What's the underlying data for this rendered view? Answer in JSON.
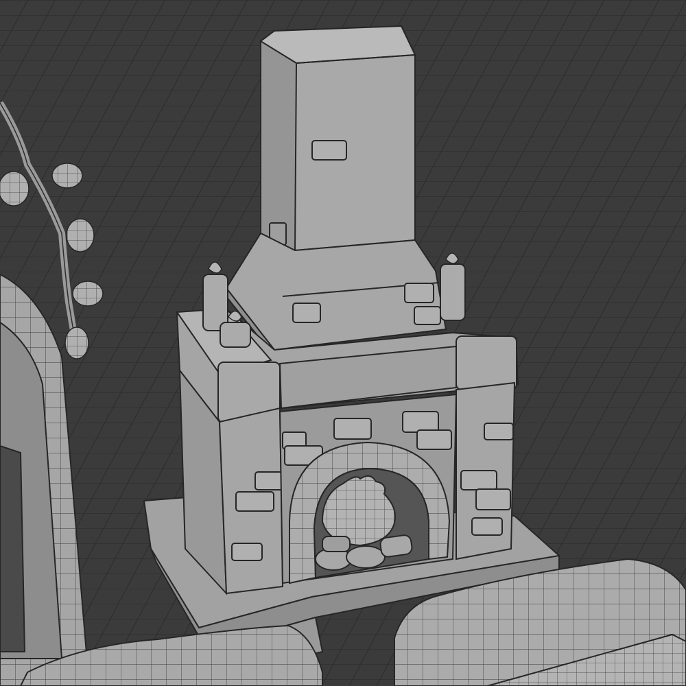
{
  "viewport": {
    "background_color": "#3b3b3b",
    "grid_color": "#2a2a2a",
    "mesh_fill": "#a8a8a8",
    "mesh_shadow": "#8a8a8a",
    "mesh_highlight": "#bdbdbd",
    "wire_color": "#2e2e2e"
  },
  "scene": {
    "objects": [
      {
        "name": "fireplace",
        "parts": [
          "chimney",
          "hood",
          "mantel",
          "pillars",
          "candles",
          "arch",
          "fire",
          "logs",
          "hearth"
        ]
      },
      {
        "name": "window-frame"
      },
      {
        "name": "hanging-berry-branch"
      },
      {
        "name": "sofa-left"
      },
      {
        "name": "sofa-right"
      }
    ]
  }
}
